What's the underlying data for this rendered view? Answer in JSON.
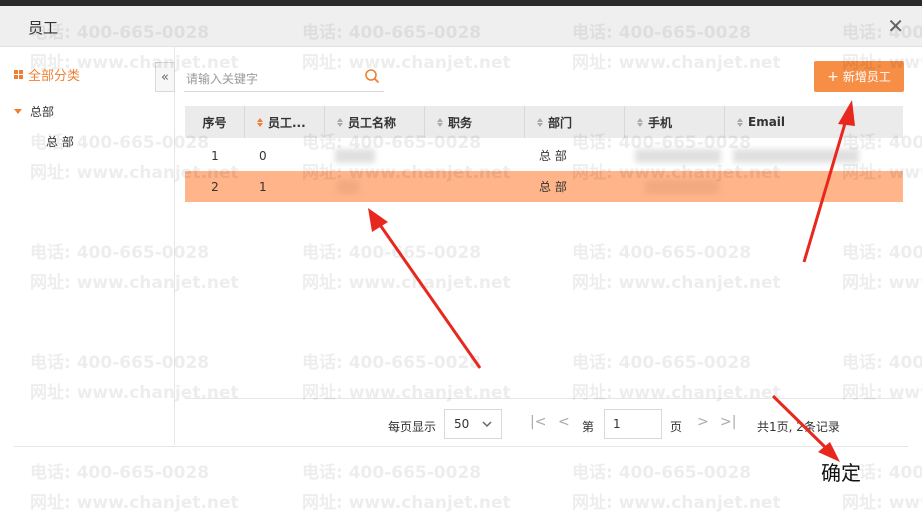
{
  "window": {
    "title": "员工",
    "close_glyph": "✕"
  },
  "sidebar": {
    "all_label": "全部分类",
    "collapse_glyph": "«",
    "tree": [
      {
        "label": "总部",
        "children": [
          {
            "label": "总 部"
          }
        ]
      }
    ]
  },
  "search": {
    "placeholder": "请输入关键字",
    "value": ""
  },
  "toolbar": {
    "add_label": "新增员工",
    "add_glyph": "+"
  },
  "table": {
    "columns": [
      "序号",
      "员工...",
      "员工名称",
      "职务",
      "部门",
      "手机",
      "Email"
    ],
    "rows": [
      {
        "index": "1",
        "code": "0",
        "name": "",
        "title": "",
        "dept": "总 部",
        "phone": "",
        "email": ""
      },
      {
        "index": "2",
        "code": "1",
        "name": "",
        "title": "",
        "dept": "总 部",
        "phone": "",
        "email": ""
      }
    ],
    "selected_row": 2
  },
  "pagination": {
    "per_page_label": "每页显示",
    "per_page_value": "50",
    "first_glyph": "|<",
    "prev_glyph": "<",
    "page_prefix": "第",
    "page_value": "1",
    "page_suffix": "页",
    "next_glyph": ">",
    "last_glyph": ">|",
    "summary": "共1页, 2条记录"
  },
  "footer": {
    "confirm_label": "确定"
  },
  "watermark": {
    "phone": "电话: 400-665-0028",
    "site": "网址: www.chanjet.net"
  },
  "colors": {
    "accent": "#f68e46",
    "selected_row": "#ffb489",
    "annotation_arrow": "#e8281e"
  },
  "icons": [
    "close-icon",
    "grid-icon",
    "collapse-icon",
    "caret-down-icon",
    "search-icon",
    "plus-icon",
    "sort-icon",
    "chevron-down-icon"
  ]
}
